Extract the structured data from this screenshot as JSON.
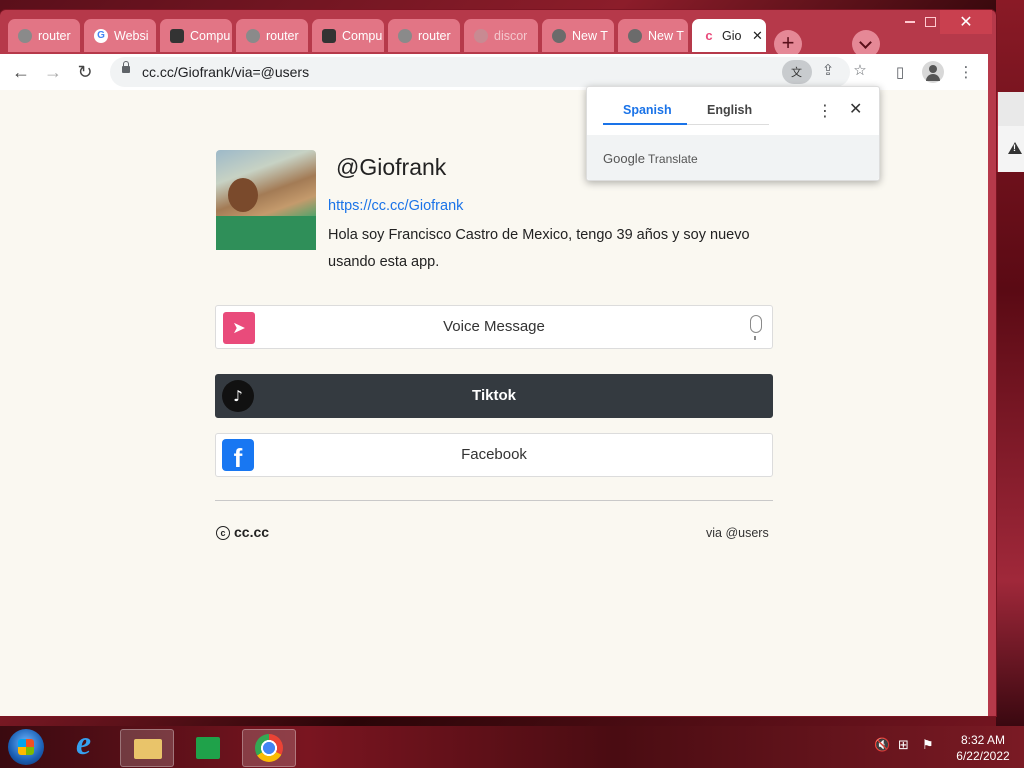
{
  "browser": {
    "tabs": [
      {
        "label": "router",
        "icon": "globe-icon"
      },
      {
        "label": "Websi",
        "icon": "google-icon"
      },
      {
        "label": "Compu",
        "icon": "cube-icon"
      },
      {
        "label": "router",
        "icon": "globe-icon"
      },
      {
        "label": "Compu",
        "icon": "cube-icon"
      },
      {
        "label": "router",
        "icon": "globe-icon"
      },
      {
        "label": "discor",
        "icon": "globe-icon"
      },
      {
        "label": "New T",
        "icon": "chrome-icon"
      },
      {
        "label": "New T",
        "icon": "chrome-icon"
      },
      {
        "label": "Gio",
        "icon": "cc-icon",
        "active": true
      }
    ],
    "new_tab_symbol": "+",
    "close_symbol": "✕",
    "url": "cc.cc/Giofrank/via=@users"
  },
  "translate_popup": {
    "source_lang": "Spanish",
    "target_lang": "English",
    "footer_brand": "Google",
    "footer_product": "Translate",
    "more_symbol": "⋮",
    "close_symbol": "✕"
  },
  "profile": {
    "handle": "@Giofrank",
    "link": "https://cc.cc/Giofrank",
    "bio": "Hola soy Francisco Castro de Mexico, tengo 39 años y soy nuevo usando esta app."
  },
  "links": [
    {
      "label": "Voice Message",
      "icon": "send-icon",
      "style": "light"
    },
    {
      "label": "Tiktok",
      "icon": "tiktok-icon",
      "style": "dark"
    },
    {
      "label": "Facebook",
      "icon": "facebook-icon",
      "style": "light"
    }
  ],
  "footer": {
    "brand": "cc.cc",
    "via": "via @users"
  },
  "taskbar": {
    "time": "8:32 AM",
    "date": "6/22/2022"
  },
  "colors": {
    "accent_pink": "#e94b7b",
    "link_blue": "#1a73e8",
    "tab_bar": "#b6394a",
    "dark_card": "#343a40"
  }
}
